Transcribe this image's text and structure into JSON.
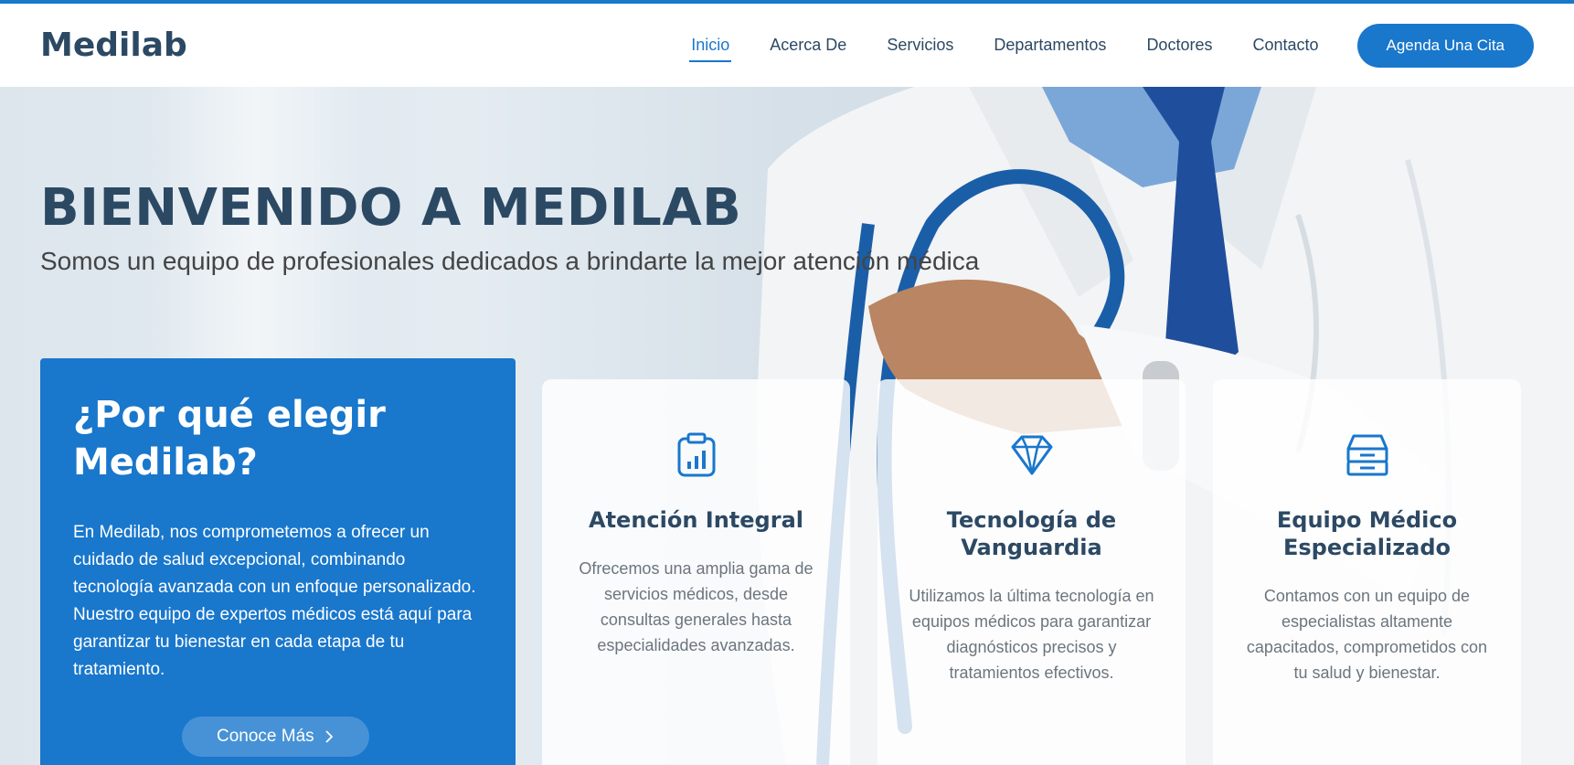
{
  "header": {
    "logo": "Medilab",
    "nav": [
      {
        "label": "Inicio"
      },
      {
        "label": "Acerca De"
      },
      {
        "label": "Servicios"
      },
      {
        "label": "Departamentos"
      },
      {
        "label": "Doctores"
      },
      {
        "label": "Contacto"
      }
    ],
    "active_nav": "Inicio",
    "cta_label": "Agenda Una Cita"
  },
  "hero": {
    "title": "BIENVENIDO A MEDILAB",
    "subtitle": "Somos un equipo de profesionales dedicados a brindarte la mejor atención médica"
  },
  "why": {
    "title": "¿Por qué elegir Medilab?",
    "text": "En Medilab, nos comprometemos a ofrecer un cuidado de salud excepcional, combinando tecnología avanzada con un enfoque personalizado. Nuestro equipo de expertos médicos está aquí para garantizar tu bienestar en cada etapa de tu tratamiento.",
    "button_label": "Conoce Más"
  },
  "cards": [
    {
      "icon": "clipboard-chart-icon",
      "title": "Atención Integral",
      "text": "Ofrecemos una amplia gama de servicios médicos, desde consultas generales hasta especialidades avanzadas."
    },
    {
      "icon": "gem-icon",
      "title": "Tecnología de Vanguardia",
      "text": "Utilizamos la última tecnología en equipos médicos para garantizar diagnósticos precisos y tratamientos efectivos."
    },
    {
      "icon": "inbox-icon",
      "title": "Equipo Médico Especializado",
      "text": "Contamos con un equipo de especialistas altamente capacitados, comprometidos con tu salud y bienestar."
    }
  ],
  "colors": {
    "accent": "#1977cc",
    "heading": "#2c4964",
    "muted": "#6c757d"
  }
}
